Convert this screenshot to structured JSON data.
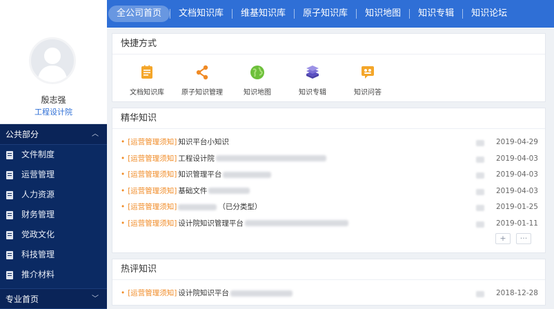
{
  "nav": {
    "items": [
      "全公司首页",
      "文档知识库",
      "维基知识库",
      "原子知识库",
      "知识地图",
      "知识专辑",
      "知识论坛"
    ]
  },
  "user": {
    "name": "殷志强",
    "dept": "工程设计院"
  },
  "sidebar": {
    "public_section": "公共部分",
    "items": [
      "文件制度",
      "运营管理",
      "人力资源",
      "财务管理",
      "党政文化",
      "科技管理",
      "推介材料"
    ],
    "bottom_section": "专业首页"
  },
  "shortcuts": {
    "title": "快捷方式",
    "items": [
      {
        "label": "文档知识库",
        "icon": "document-icon",
        "color": "#f4a62a"
      },
      {
        "label": "原子知识管理",
        "icon": "share-icon",
        "color": "#f08a24"
      },
      {
        "label": "知识地图",
        "icon": "globe-icon",
        "color": "#6cbf3a"
      },
      {
        "label": "知识专辑",
        "icon": "books-icon",
        "color": "#7b6fd6"
      },
      {
        "label": "知识问答",
        "icon": "chat-icon",
        "color": "#f4a62a"
      }
    ]
  },
  "featured": {
    "title": "精华知识",
    "rows": [
      {
        "tag": "[运营管理须知]",
        "title": "知识平台小知识",
        "date": "2019-04-29"
      },
      {
        "tag": "[运营管理须知]",
        "title": "工程设计院",
        "date": "2019-04-03"
      },
      {
        "tag": "[运营管理须知]",
        "title": "知识管理平台",
        "date": "2019-04-03"
      },
      {
        "tag": "[运营管理须知]",
        "title": "基础文件",
        "date": "2019-04-03"
      },
      {
        "tag": "[运营管理须知]",
        "title": "（已分类型）",
        "date": "2019-01-25"
      },
      {
        "tag": "[运营管理须知]",
        "title": "设计院知识管理平台",
        "date": "2019-01-11"
      }
    ],
    "add_label": "+",
    "more_label": "···"
  },
  "hot": {
    "title": "热评知识",
    "rows": [
      {
        "tag": "[运营管理须知]",
        "title": "设计院知识平台",
        "date": "2018-12-28"
      }
    ]
  },
  "colors": {
    "nav_bg": "#2f6fd6",
    "sidebar_bg": "#0b2a63",
    "accent_orange": "#f08a24",
    "dept_blue": "#2f6fd6"
  }
}
